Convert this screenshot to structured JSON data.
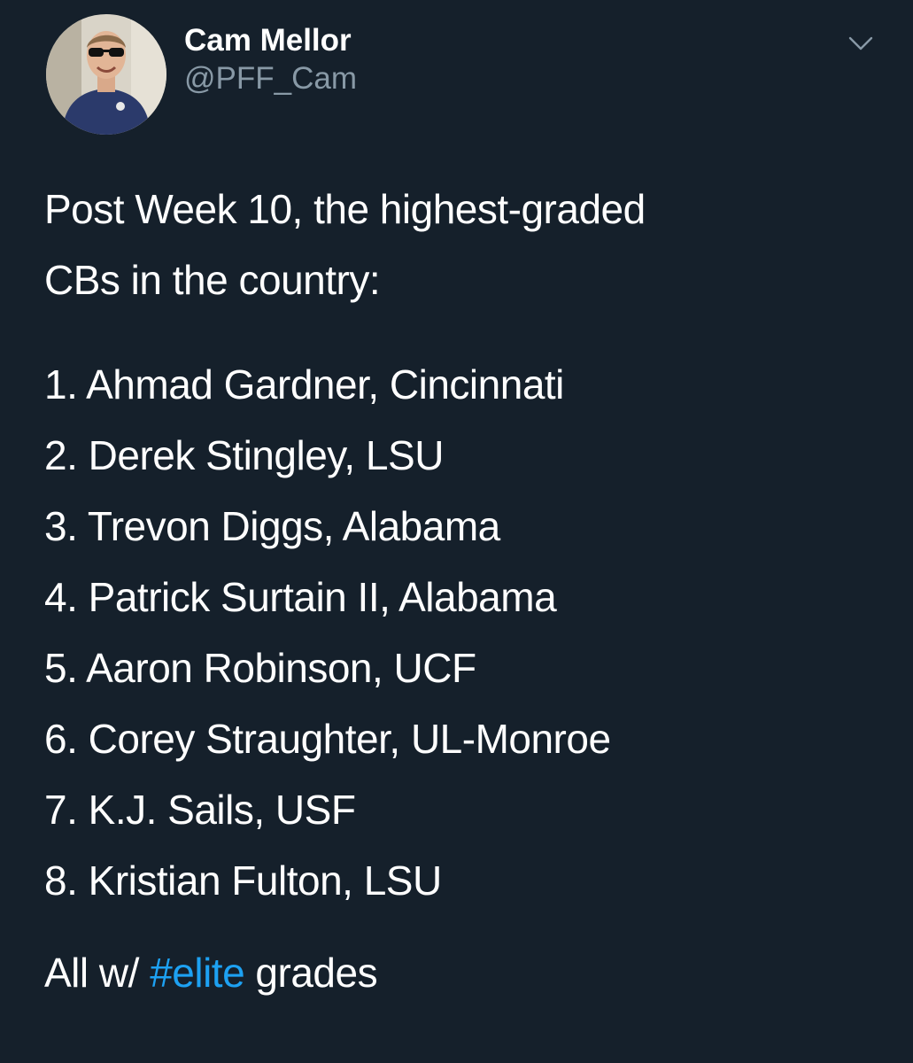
{
  "author": {
    "display_name": "Cam Mellor",
    "handle": "@PFF_Cam"
  },
  "icons": {
    "menu": "chevron-down-icon"
  },
  "colors": {
    "background": "#15202b",
    "text": "#ffffff",
    "secondary_text": "#8899a6",
    "link": "#1da1f2"
  },
  "tweet": {
    "intro_line1": "Post Week 10, the highest-graded",
    "intro_line2": "CBs in the country:",
    "list": [
      "1. Ahmad Gardner, Cincinnati",
      "2. Derek Stingley, LSU",
      "3. Trevon Diggs, Alabama",
      "4. Patrick Surtain II, Alabama",
      "5. Aaron Robinson, UCF",
      "6. Corey Straughter, UL-Monroe",
      "7. K.J. Sails, USF",
      "8. Kristian Fulton, LSU"
    ],
    "outro_prefix": "All w/ ",
    "hashtag": "#elite",
    "outro_suffix": " grades"
  }
}
